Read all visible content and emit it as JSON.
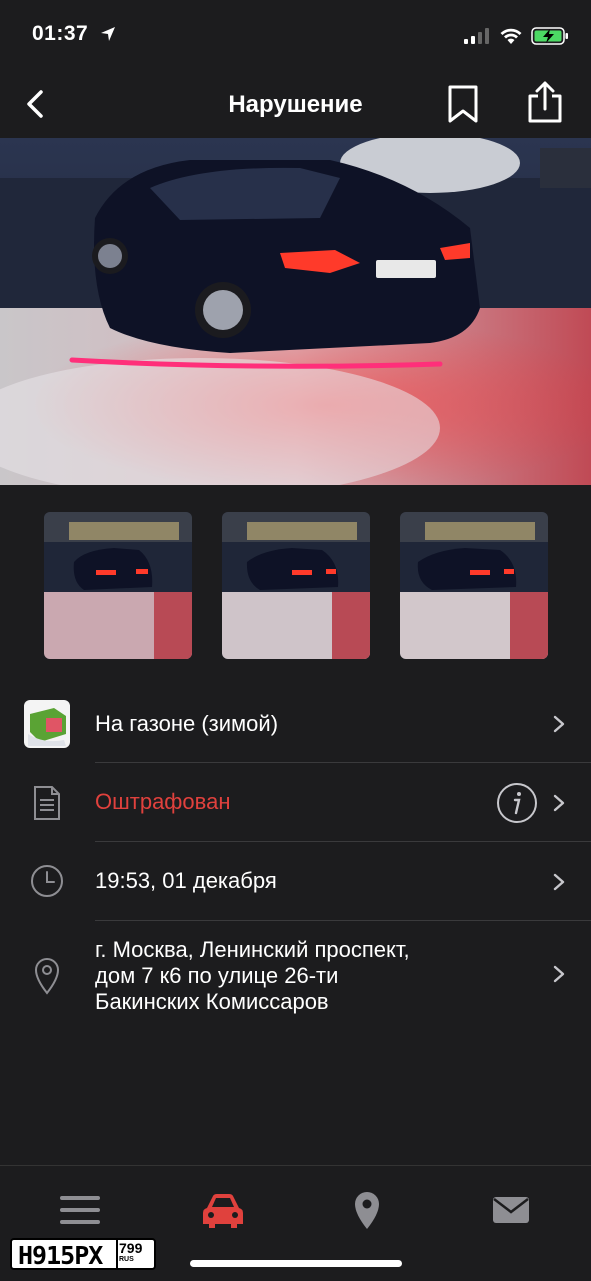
{
  "status_bar": {
    "time": "01:37"
  },
  "header": {
    "title": "Нарушение"
  },
  "violation": {
    "type": "На газоне (зимой)",
    "status": "Оштрафован",
    "datetime": "19:53, 01 декабря",
    "address_lines": [
      "г. Москва, Ленинский проспект,",
      "дом 7 к6 по улице 26-ти",
      "Бакинских Комиссаров"
    ]
  },
  "plate": {
    "number": "H915PX",
    "region": "799",
    "country": "RUS"
  },
  "colors": {
    "background": "#1c1c1e",
    "status_fined": "#e0413d",
    "tab_active": "#e0413d",
    "tab_inactive": "#8e8e93"
  },
  "tabs": [
    {
      "icon": "menu-icon",
      "active": false
    },
    {
      "icon": "car-icon",
      "active": true
    },
    {
      "icon": "map-pin-icon",
      "active": false
    },
    {
      "icon": "mail-icon",
      "active": false
    }
  ]
}
